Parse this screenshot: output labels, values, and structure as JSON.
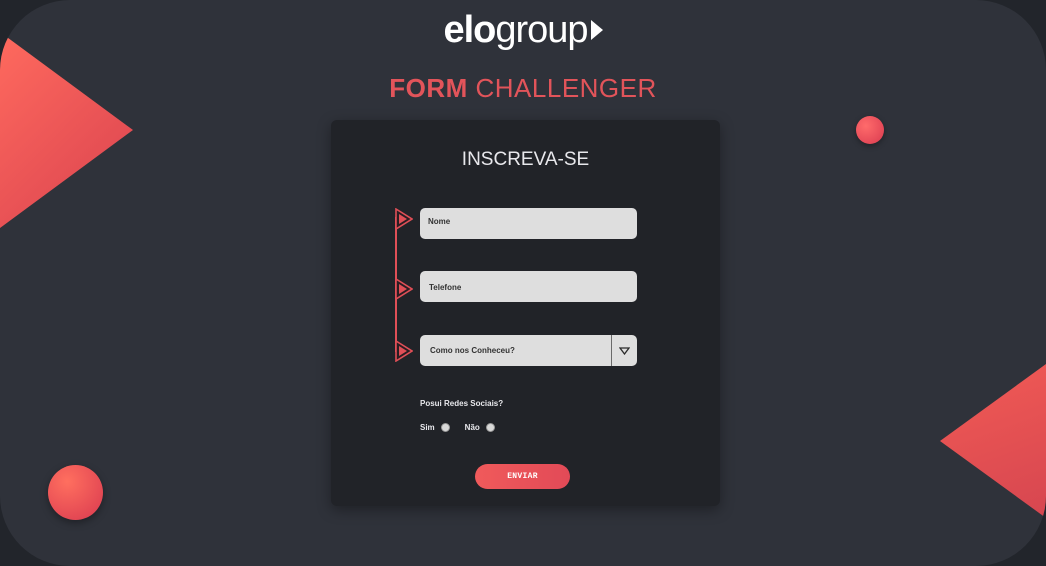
{
  "brand": {
    "logo_bold": "elo",
    "logo_light": "group",
    "logo_icon": "play-icon"
  },
  "page": {
    "heading_bold": "FORM",
    "heading_rest": "CHALLENGER"
  },
  "form": {
    "title": "INSCREVA-SE",
    "fields": {
      "name": {
        "placeholder": "Nome"
      },
      "phone": {
        "placeholder": "Telefone"
      },
      "source": {
        "placeholder": "Como nos Conheceu?",
        "icon": "chevron-down-icon"
      }
    },
    "social": {
      "question": "Posui Redes Sociais?",
      "options": [
        "Sim",
        "Não"
      ]
    },
    "submit_label": "ENVIAR"
  },
  "colors": {
    "accent": "#e2545a",
    "background": "#2f323a",
    "card": "#212328",
    "field": "#dedede"
  }
}
